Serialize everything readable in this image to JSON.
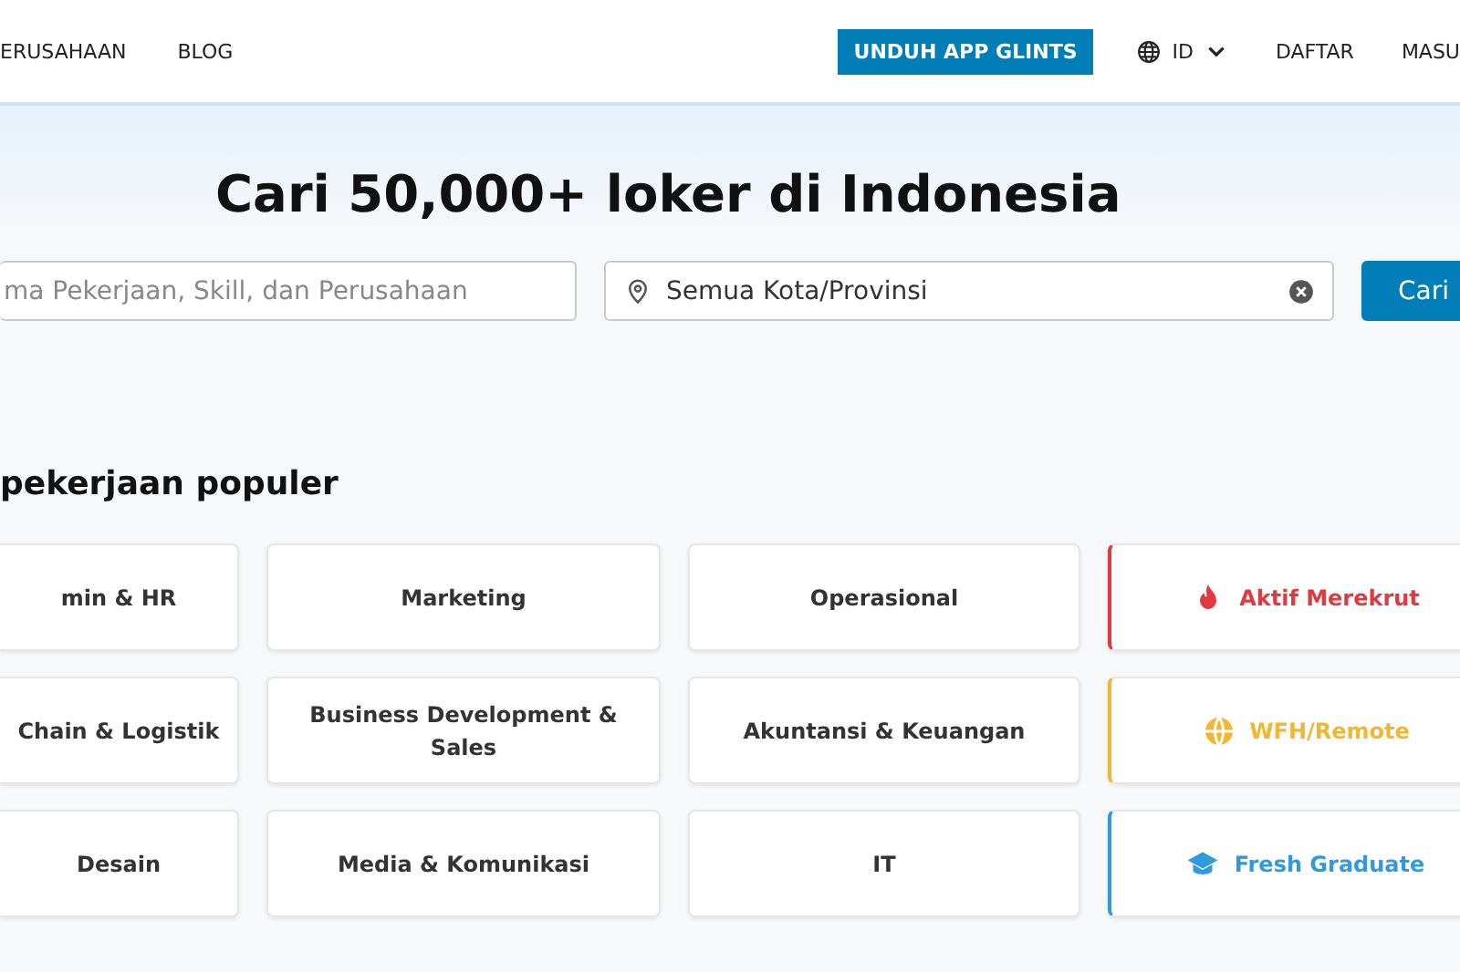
{
  "nav": {
    "links_left": [
      "ERUSAHAAN",
      "BLOG"
    ],
    "download_button": "UNDUH APP GLINTS",
    "language": "ID",
    "links_right": [
      "DAFTAR",
      "MASU"
    ]
  },
  "hero": {
    "title": "Cari 50,000+ loker di Indonesia",
    "keyword_field": {
      "placeholder": "ma Pekerjaan, Skill, dan Perusahaan"
    },
    "location_field": {
      "value": "Semua Kota/Provinsi"
    },
    "search_button": "Cari"
  },
  "popular": {
    "title": "pekerjaan populer",
    "cards": [
      {
        "kind": "category",
        "label": "min & HR"
      },
      {
        "kind": "category",
        "label": "Marketing"
      },
      {
        "kind": "category",
        "label": "Operasional"
      },
      {
        "kind": "hiring",
        "label": "Aktif Merekrut",
        "color": "#e0393e"
      },
      {
        "kind": "category",
        "label": "Chain & Logistik"
      },
      {
        "kind": "category",
        "label": "Business Development & Sales"
      },
      {
        "kind": "category",
        "label": "Akuntansi & Keuangan"
      },
      {
        "kind": "remote",
        "label": "WFH/Remote",
        "color": "#f2b630"
      },
      {
        "kind": "category",
        "label": "Desain"
      },
      {
        "kind": "category",
        "label": "Media & Komunikasi"
      },
      {
        "kind": "category",
        "label": "IT"
      },
      {
        "kind": "graduate",
        "label": "Fresh Graduate",
        "color": "#2f9ae0"
      }
    ]
  }
}
